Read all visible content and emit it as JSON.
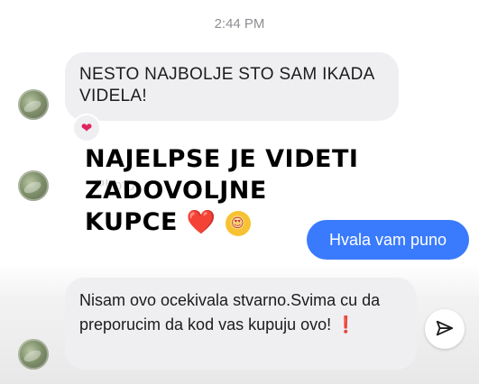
{
  "thread": {
    "timestamp": "2:44 PM"
  },
  "messages": [
    {
      "text": "NESTO NAJBOLJE STO SAM IKADA VIDELA!",
      "reaction": "❤"
    },
    {
      "text": "Photo"
    },
    {
      "text": "Hvala vam puno"
    },
    {
      "text": "Nisam ovo ocekivala stvarno.Svima cu da preporucim da kod vas kupuju ovo!",
      "emoji": "❗"
    }
  ],
  "overlay": {
    "line1": "NAJELPSE JE VIDETI ZADOVOLJNE",
    "line2": "KUPCE",
    "heart": "❤️",
    "face": "😍"
  },
  "colors": {
    "incoming_bubble": "#efeff2",
    "outgoing_bubble": "#3a7bfd",
    "reaction_heart": "#e0245e"
  },
  "icons": {
    "send": "send-icon"
  }
}
